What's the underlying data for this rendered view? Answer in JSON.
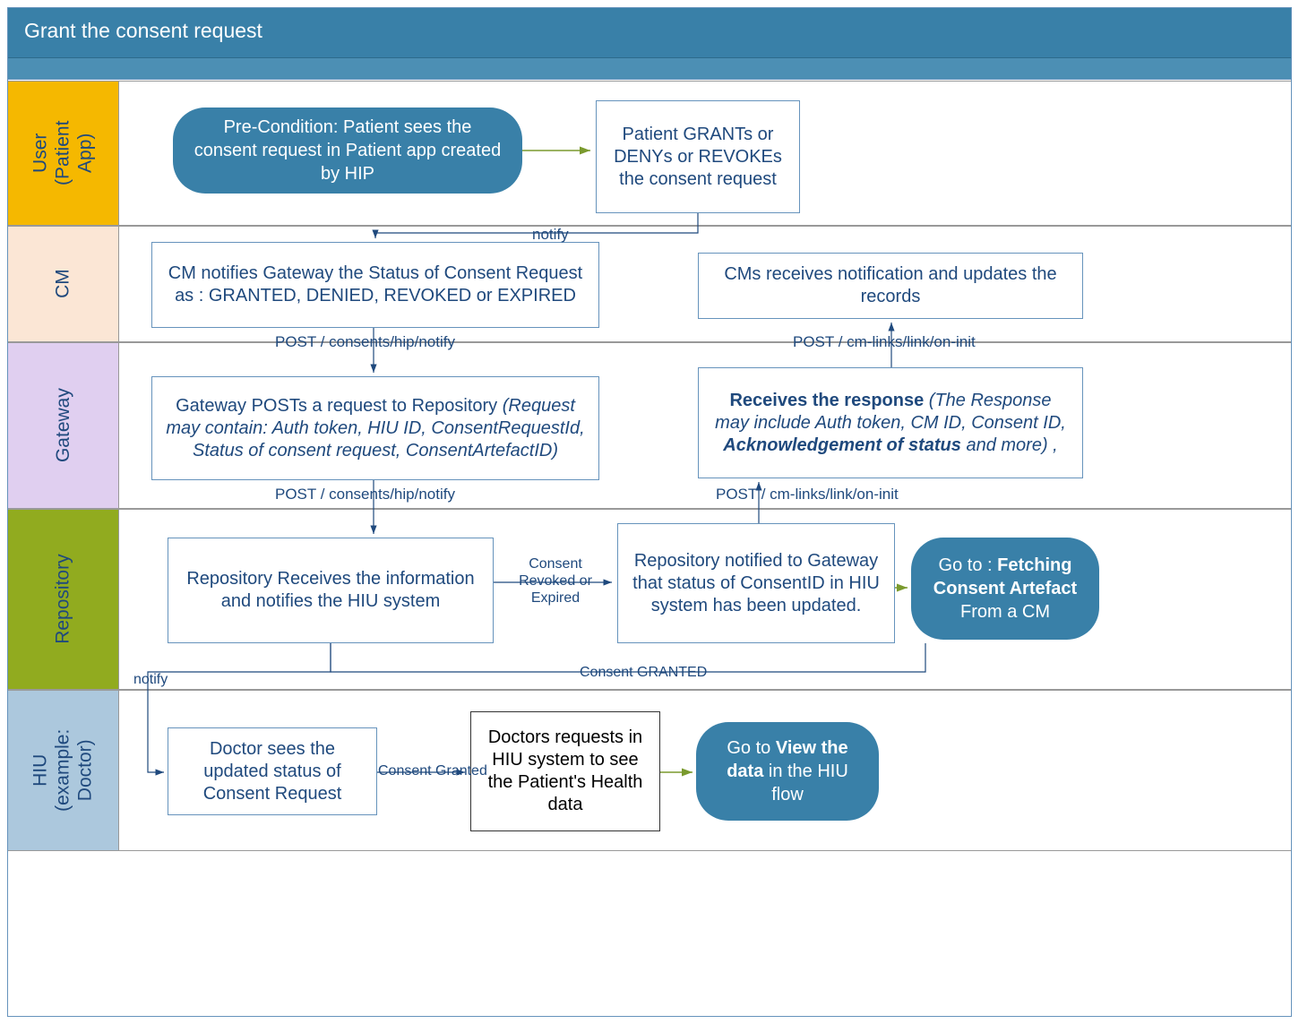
{
  "title": "Grant the consent request",
  "lanes": {
    "user": "User\n(Patient\nApp)",
    "cm": "CM",
    "gateway": "Gateway",
    "repo": "Repository",
    "hiu": "HIU\n(example:\nDoctor)"
  },
  "nodes": {
    "precondition": "Pre-Condition: Patient sees the consent request in Patient app created by HIP",
    "patient_action": "Patient GRANTs or DENYs or REVOKEs the consent request",
    "cm_notify": "CM notifies Gateway the Status of Consent Request as : GRANTED, DENIED, REVOKED or EXPIRED",
    "cm_receives": "CMs receives notification and updates the records",
    "gateway_post_prefix": "Gateway POSTs a request to Repository ",
    "gateway_post_detail": "(Request may contain: Auth token, HIU ID, ConsentRequestId, Status of consent request, ConsentArtefactID)",
    "receives_response_bold": "Receives the response ",
    "receives_response_detail": "(The Response may include Auth token, CM ID, Consent ID, ",
    "receives_response_bold2": "Acknowledgement of status",
    "receives_response_detail2": " and more) ,",
    "repo_receives": "Repository Receives the information and notifies the HIU system",
    "repo_notified": "Repository notified to Gateway that status of ConsentID in HIU system has been updated.",
    "goto_fetch_pre": "Go to : ",
    "goto_fetch_bold": "Fetching Consent Artefact",
    "goto_fetch_post": " From a CM",
    "doctor_sees": "Doctor sees the updated status of Consent Request",
    "doctor_requests": "Doctors requests in HIU system to see the Patient's Health data",
    "goto_view_pre": "Go to ",
    "goto_view_bold": "View the data",
    "goto_view_post": " in the HIU flow"
  },
  "edges": {
    "notify1": "notify",
    "post_hip1": "POST / consents/hip/notify",
    "post_hip2": "POST / consents/hip/notify",
    "post_oninit1": "POST / cm-links/link/on-init",
    "post_oninit2": "POST / cm-links/link/on-init",
    "revoked": "Consent Revoked or Expired",
    "granted": "Consent GRANTED",
    "notify2": "notify",
    "consent_granted": "Consent Granted"
  }
}
